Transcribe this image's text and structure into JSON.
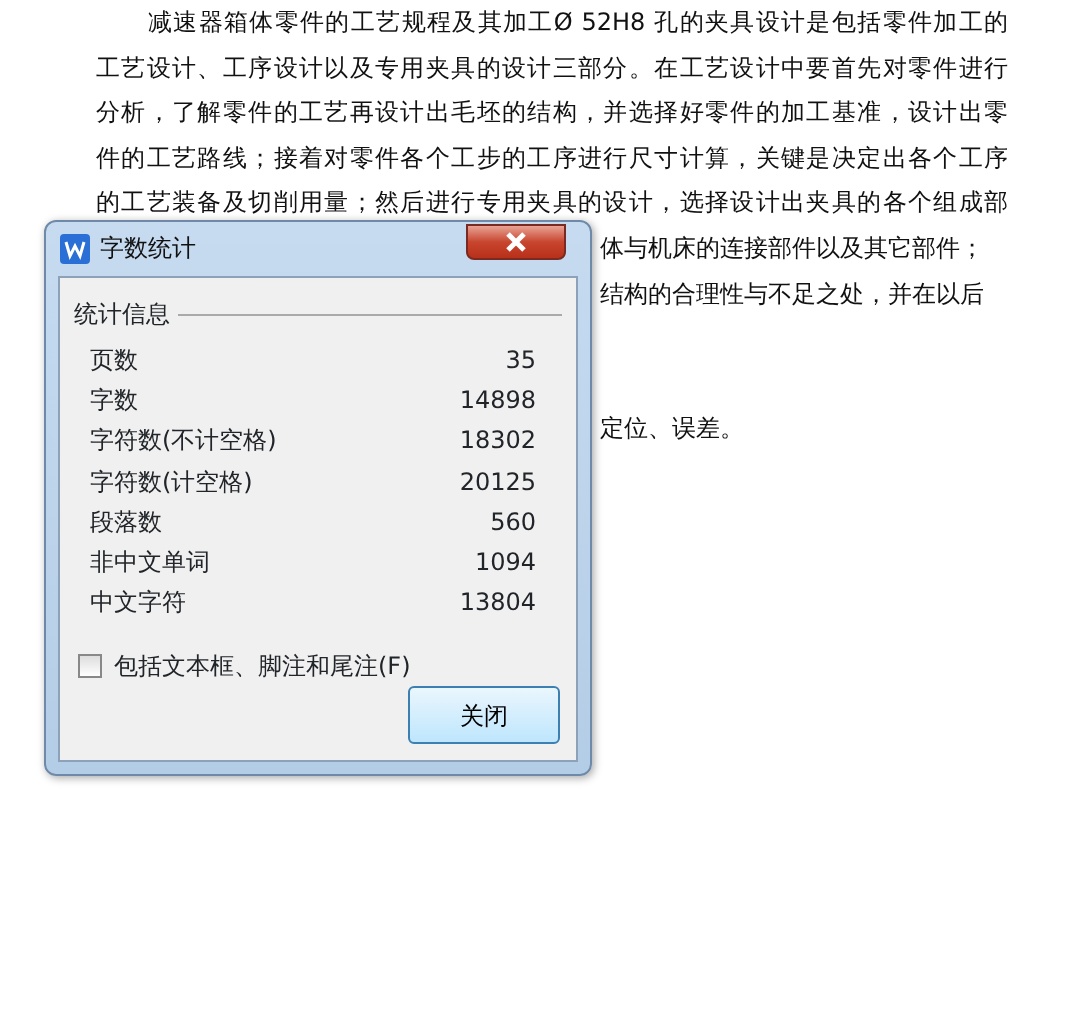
{
  "document": {
    "paragraphs": [
      {
        "kind": "indent",
        "text": "减速器箱体零件的工艺规程及其加工Ø 52H8 孔的夹具设计是包括零件加工的"
      },
      {
        "kind": "full",
        "text": "工艺设计、工序设计以及专用夹具的设计三部分。在工艺设计中要首先对零件进行"
      },
      {
        "kind": "full",
        "text": "分析，了解零件的工艺再设计出毛坯的结构，并选择好零件的加工基准，设计出零"
      },
      {
        "kind": "full",
        "text": "件的工艺路线；接着对零件各个工步的工序进行尺寸计算，关键是决定出各个工序"
      },
      {
        "kind": "full",
        "text": "的工艺装备及切削用量；然后进行专用夹具的设计，选择设计出夹具的各个组成部"
      },
      {
        "kind": "fragment",
        "text": "体与机床的连接部件以及其它部件；"
      },
      {
        "kind": "fragment",
        "text": "结构的合理性与不足之处，并在以后"
      },
      {
        "kind": "blank"
      },
      {
        "kind": "blank"
      },
      {
        "kind": "fragment",
        "text": "定位、误差。"
      }
    ]
  },
  "dialog": {
    "title": "字数统计",
    "group": "统计信息",
    "stats": [
      {
        "label": "页数",
        "value": "35"
      },
      {
        "label": "字数",
        "value": "14898"
      },
      {
        "label": "字符数(不计空格)",
        "value": "18302"
      },
      {
        "label": "字符数(计空格)",
        "value": "20125"
      },
      {
        "label": "段落数",
        "value": "560"
      },
      {
        "label": "非中文单词",
        "value": "1094"
      },
      {
        "label": "中文字符",
        "value": "13804"
      }
    ],
    "checkbox": {
      "label": "包括文本框、脚注和尾注(F)",
      "checked": false
    },
    "button": "关闭"
  }
}
